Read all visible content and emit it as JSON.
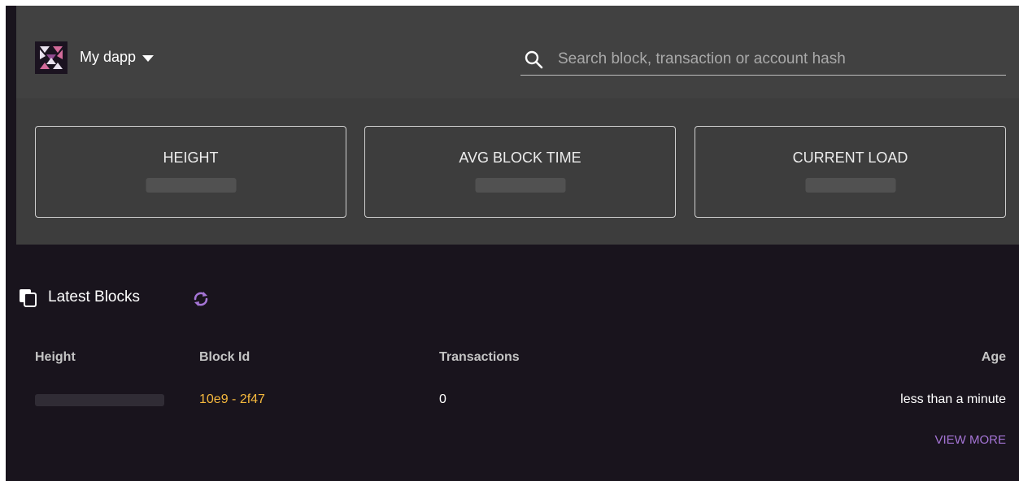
{
  "header": {
    "app_name": "My dapp",
    "search_placeholder": "Search block, transaction or account hash"
  },
  "stats": [
    {
      "label": "HEIGHT"
    },
    {
      "label": "AVG BLOCK TIME"
    },
    {
      "label": "CURRENT LOAD"
    }
  ],
  "latest_blocks": {
    "title": "Latest Blocks",
    "columns": [
      "Height",
      "Block Id",
      "Transactions",
      "Age"
    ],
    "rows": [
      {
        "height": "",
        "block_id": "10e9 - 2f47",
        "transactions": "0",
        "age": "less than a minute"
      }
    ],
    "view_more": "VIEW MORE"
  },
  "colors": {
    "background": "#19141d",
    "header": "#414141",
    "link": "#f5b83d",
    "accent": "#a575d6"
  }
}
